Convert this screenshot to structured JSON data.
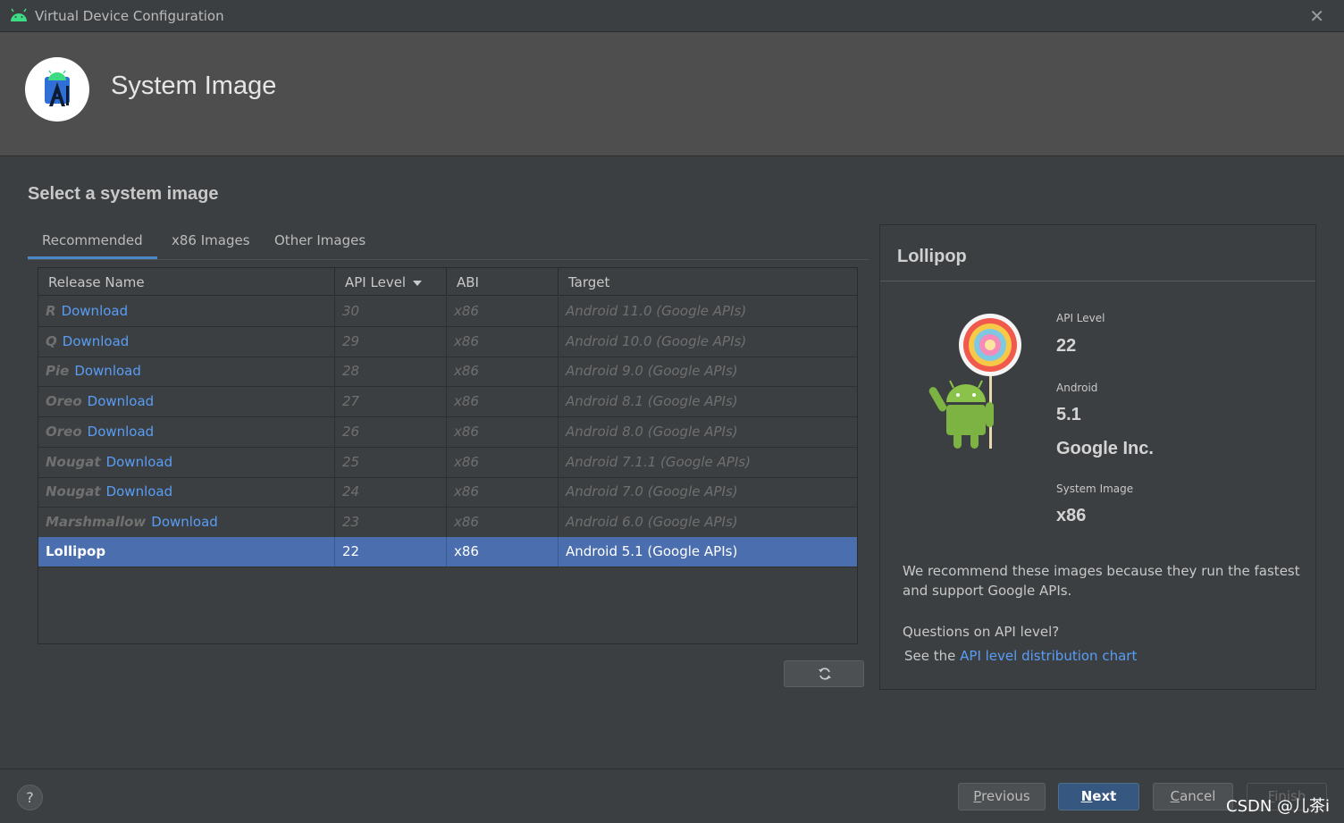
{
  "window": {
    "title": "Virtual Device Configuration",
    "close_glyph": "✕"
  },
  "header": {
    "title": "System Image"
  },
  "section_title": "Select a system image",
  "tabs": [
    {
      "label": "Recommended",
      "active": true
    },
    {
      "label": "x86 Images",
      "active": false
    },
    {
      "label": "Other Images",
      "active": false
    }
  ],
  "table": {
    "columns": [
      "Release Name",
      "API Level",
      "ABI",
      "Target"
    ],
    "rows": [
      {
        "name": "R",
        "action": "Download",
        "api": "30",
        "abi": "x86",
        "target": "Android 11.0 (Google APIs)"
      },
      {
        "name": "Q",
        "action": "Download",
        "api": "29",
        "abi": "x86",
        "target": "Android 10.0 (Google APIs)"
      },
      {
        "name": "Pie",
        "action": "Download",
        "api": "28",
        "abi": "x86",
        "target": "Android 9.0 (Google APIs)"
      },
      {
        "name": "Oreo",
        "action": "Download",
        "api": "27",
        "abi": "x86",
        "target": "Android 8.1 (Google APIs)"
      },
      {
        "name": "Oreo",
        "action": "Download",
        "api": "26",
        "abi": "x86",
        "target": "Android 8.0 (Google APIs)"
      },
      {
        "name": "Nougat",
        "action": "Download",
        "api": "25",
        "abi": "x86",
        "target": "Android 7.1.1 (Google APIs)"
      },
      {
        "name": "Nougat",
        "action": "Download",
        "api": "24",
        "abi": "x86",
        "target": "Android 7.0 (Google APIs)"
      },
      {
        "name": "Marshmallow",
        "action": "Download",
        "api": "23",
        "abi": "x86",
        "target": "Android 6.0 (Google APIs)"
      },
      {
        "name": "Lollipop",
        "action": "",
        "api": "22",
        "abi": "x86",
        "target": "Android 5.1 (Google APIs)",
        "selected": true
      }
    ]
  },
  "detail": {
    "title": "Lollipop",
    "api_level_label": "API Level",
    "api_level_value": "22",
    "android_label": "Android",
    "android_value": "5.1",
    "vendor": "Google Inc.",
    "system_image_label": "System Image",
    "system_image_value": "x86",
    "recommend_text": "We recommend these images because they run the fastest and support Google APIs.",
    "question_text": "Questions on API level?",
    "see_prefix": "See the ",
    "link_text": "API level distribution chart"
  },
  "footer": {
    "help": "?",
    "previous": {
      "mnemonic": "P",
      "rest": "revious"
    },
    "next": {
      "mnemonic": "N",
      "rest": "ext"
    },
    "cancel": {
      "mnemonic": "C",
      "rest": "ancel"
    },
    "finish": {
      "mnemonic": "F",
      "rest": "inish"
    }
  },
  "watermark": "CSDN @儿茶i",
  "colors": {
    "accent": "#4a88c7",
    "link": "#589df6",
    "selection": "#4b6eaf",
    "background": "#3c3f41"
  }
}
